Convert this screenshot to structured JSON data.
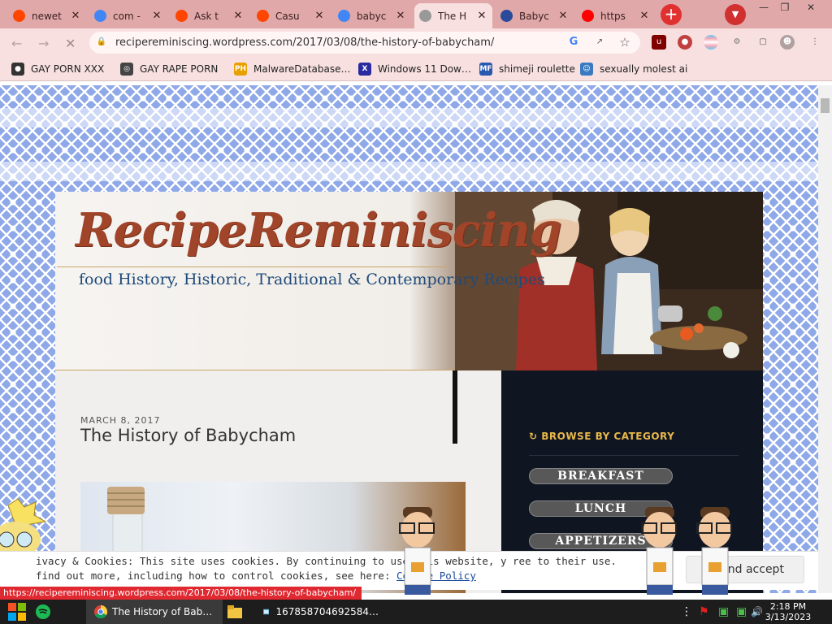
{
  "browser": {
    "tabs": [
      {
        "title": "newet",
        "icon": "reddit-icon",
        "color": "#ff4500"
      },
      {
        "title": "com -",
        "icon": "google-icon",
        "color": "#4285f4"
      },
      {
        "title": "Ask t",
        "icon": "reddit-icon",
        "color": "#ff4500"
      },
      {
        "title": "Casu",
        "icon": "reddit-icon",
        "color": "#ff4500"
      },
      {
        "title": "babyc",
        "icon": "google-icon",
        "color": "#4285f4"
      },
      {
        "title": "The H",
        "icon": "loading-icon",
        "color": "#999999",
        "active": true
      },
      {
        "title": "Babyc",
        "icon": "merriam-webster-icon",
        "color": "#2a4a9a"
      },
      {
        "title": "https",
        "icon": "youtube-icon",
        "color": "#ff0000"
      }
    ],
    "new_tab": "+",
    "url": "recipereminiscing.wordpress.com/2017/03/08/the-history-of-babycham/",
    "bookmarks": [
      {
        "label": "GAY PORN XXX",
        "icon": "github-icon"
      },
      {
        "label": "GAY RAPE PORN",
        "icon": "globe-icon"
      },
      {
        "label": "MalwareDatabase…",
        "icon": "ph-icon"
      },
      {
        "label": "Windows 11 Dow…",
        "icon": "x-icon"
      },
      {
        "label": "shimeji roulette",
        "icon": "mf-icon"
      },
      {
        "label": "sexually molest ai",
        "icon": "character-icon"
      }
    ]
  },
  "site": {
    "brand": "RecipeReminiscing",
    "tagline": "food History, Historic, Traditional & Contemporary Recipes",
    "post_date": "MARCH 8, 2017",
    "post_title": "The History of Babycham",
    "sidebar_heading": "BROWSE BY CATEGORY",
    "categories": [
      "BREAKFAST",
      "LUNCH",
      "APPETIZERS"
    ]
  },
  "cookie_banner": {
    "line1": "ivacy & Cookies: This site uses cookies. By continuing to use this website, y    ree to their use.",
    "line2": "find out more, including how to control cookies, see here: ",
    "link": "Cookie Policy",
    "button": "Cl    and accept"
  },
  "status_url": "https://recipereminiscing.wordpress.com/2017/03/08/the-history-of-babycham/",
  "taskbar": {
    "items": [
      "The History of Bab…",
      "167858704692584…"
    ],
    "time": "2:18 PM",
    "date": "3/13/2023"
  }
}
